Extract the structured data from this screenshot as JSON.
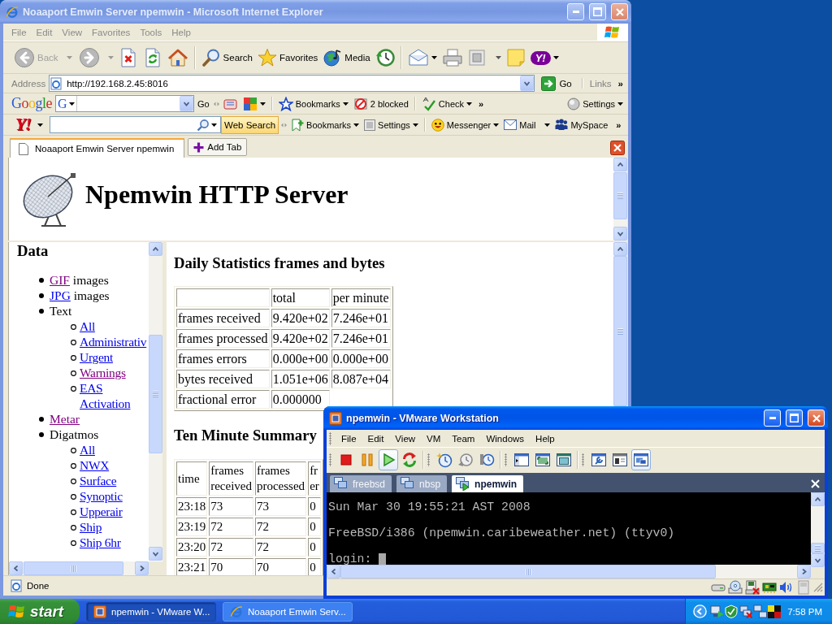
{
  "ie_window": {
    "title": "Noaaport Emwin Server npemwin - Microsoft Internet Explorer",
    "active": false,
    "menu": [
      "File",
      "Edit",
      "View",
      "Favorites",
      "Tools",
      "Help"
    ],
    "toolbar": {
      "back": {
        "label": "Back",
        "disabled": true
      },
      "forward": {
        "disabled": true
      },
      "search": {
        "label": "Search"
      },
      "favorites": {
        "label": "Favorites"
      },
      "media": {
        "label": "Media"
      },
      "logo_button": {
        "label": "Y!"
      }
    },
    "address_bar": {
      "label": "Address",
      "url": "http://192.168.2.45:8016",
      "go": "Go",
      "links": "Links",
      "more": "»"
    },
    "google_toolbar": {
      "logo": "Google",
      "engine": "G",
      "go": "Go",
      "bookmarks": "Bookmarks",
      "blocked": "2 blocked",
      "check": "Check",
      "more": "»",
      "settings": "Settings"
    },
    "yahoo_toolbar": {
      "logo": "Y!",
      "search_button": "Web Search",
      "bookmarks": "Bookmarks",
      "settings": "Settings",
      "messenger": "Messenger",
      "mail": "Mail",
      "myspace": "MySpace",
      "more": "»"
    },
    "tabs": [
      {
        "label": "Noaaport Emwin Server npemwin",
        "selected": true
      }
    ],
    "add_tab": "Add Tab",
    "page": {
      "banner": "Npemwin HTTP Server",
      "nav": {
        "heading": "Data",
        "items": [
          {
            "link": "GIF",
            "visited": true,
            "after": "images"
          },
          {
            "link": "JPG",
            "visited": false,
            "after": "images"
          },
          {
            "text": "Text",
            "children": [
              {
                "link": "All",
                "visited": false
              },
              {
                "link": "Administrativ",
                "visited": false
              },
              {
                "link": "Urgent",
                "visited": false
              },
              {
                "link": "Warnings",
                "visited": true
              },
              {
                "link": "EAS Activation",
                "visited": false
              }
            ]
          },
          {
            "link": "Metar",
            "visited": true
          },
          {
            "text": "Digatmos",
            "children": [
              {
                "link": "All",
                "visited": false
              },
              {
                "link": "NWX",
                "visited": false
              },
              {
                "link": "Surface",
                "visited": false
              },
              {
                "link": "Synoptic",
                "visited": false
              },
              {
                "link": "Upperair",
                "visited": false
              },
              {
                "link": "Ship",
                "visited": false
              },
              {
                "link": "Ship 6hr",
                "visited": false
              }
            ]
          }
        ]
      },
      "daily": {
        "heading": "Daily Statistics frames and bytes",
        "columns": [
          "",
          "total",
          "per minute"
        ],
        "rows": [
          [
            "frames received",
            "9.420e+02",
            "7.246e+01"
          ],
          [
            "frames processed",
            "9.420e+02",
            "7.246e+01"
          ],
          [
            "frames errors",
            "0.000e+00",
            "0.000e+00"
          ],
          [
            "bytes received",
            "1.051e+06",
            "8.087e+04"
          ],
          [
            "fractional error",
            "0.000000"
          ]
        ]
      },
      "summary": {
        "heading": "Ten Minute Summary",
        "columns": [
          "time",
          "frames received",
          "frames processed",
          "fr er"
        ],
        "rows": [
          [
            "23:18",
            "73",
            "73",
            "0"
          ],
          [
            "23:19",
            "72",
            "72",
            "0"
          ],
          [
            "23:20",
            "72",
            "72",
            "0"
          ],
          [
            "23:21",
            "70",
            "70",
            "0"
          ]
        ]
      }
    },
    "status": "Done"
  },
  "vmware_window": {
    "title": "npemwin - VMware Workstation",
    "active": true,
    "menu": [
      "File",
      "Edit",
      "View",
      "VM",
      "Team",
      "Windows",
      "Help"
    ],
    "toolbar": [
      {
        "buttons": [
          {
            "kind": "stop",
            "selected": false
          },
          {
            "kind": "pause",
            "selected": false
          },
          {
            "kind": "play",
            "selected": true
          },
          {
            "kind": "reset",
            "selected": false
          }
        ]
      },
      {
        "buttons": [
          {
            "kind": "snapshot",
            "selected": false
          },
          {
            "kind": "revert",
            "selected": false
          },
          {
            "kind": "manager",
            "selected": false
          }
        ]
      },
      {
        "buttons": [
          {
            "kind": "sidebar",
            "selected": false
          },
          {
            "kind": "fullscreen",
            "selected": false
          },
          {
            "kind": "quickswitch",
            "selected": false
          }
        ]
      },
      {
        "buttons": [
          {
            "kind": "summary",
            "selected": false
          },
          {
            "kind": "appliance",
            "selected": false
          },
          {
            "kind": "console",
            "selected": true
          }
        ]
      }
    ],
    "tabs": [
      {
        "label": "freebsd",
        "selected": false,
        "running": false
      },
      {
        "label": "nbsp",
        "selected": false,
        "running": false
      },
      {
        "label": "npemwin",
        "selected": true,
        "running": true
      }
    ],
    "console": {
      "lines": [
        "Sun Mar 30 19:55:21 AST 2008",
        "FreeBSD/i386 (npemwin.caribeweather.net) (ttyv0)"
      ],
      "prompt": "login:"
    },
    "devices": [
      {
        "kind": "drive",
        "connected": true
      },
      {
        "kind": "disc",
        "connected": true
      },
      {
        "kind": "floppy",
        "connected": false
      },
      {
        "kind": "network",
        "connected": true
      },
      {
        "kind": "sound",
        "connected": true
      },
      {
        "kind": "usb",
        "connected": true
      }
    ]
  },
  "taskbar": {
    "start": "start",
    "tasks": [
      {
        "kind": "vm",
        "label": "npemwin - VMware W...",
        "selected": true
      },
      {
        "kind": "browser",
        "label": "Noaaport Emwin Serv...",
        "selected": false
      }
    ],
    "clock": "7:58 PM"
  }
}
